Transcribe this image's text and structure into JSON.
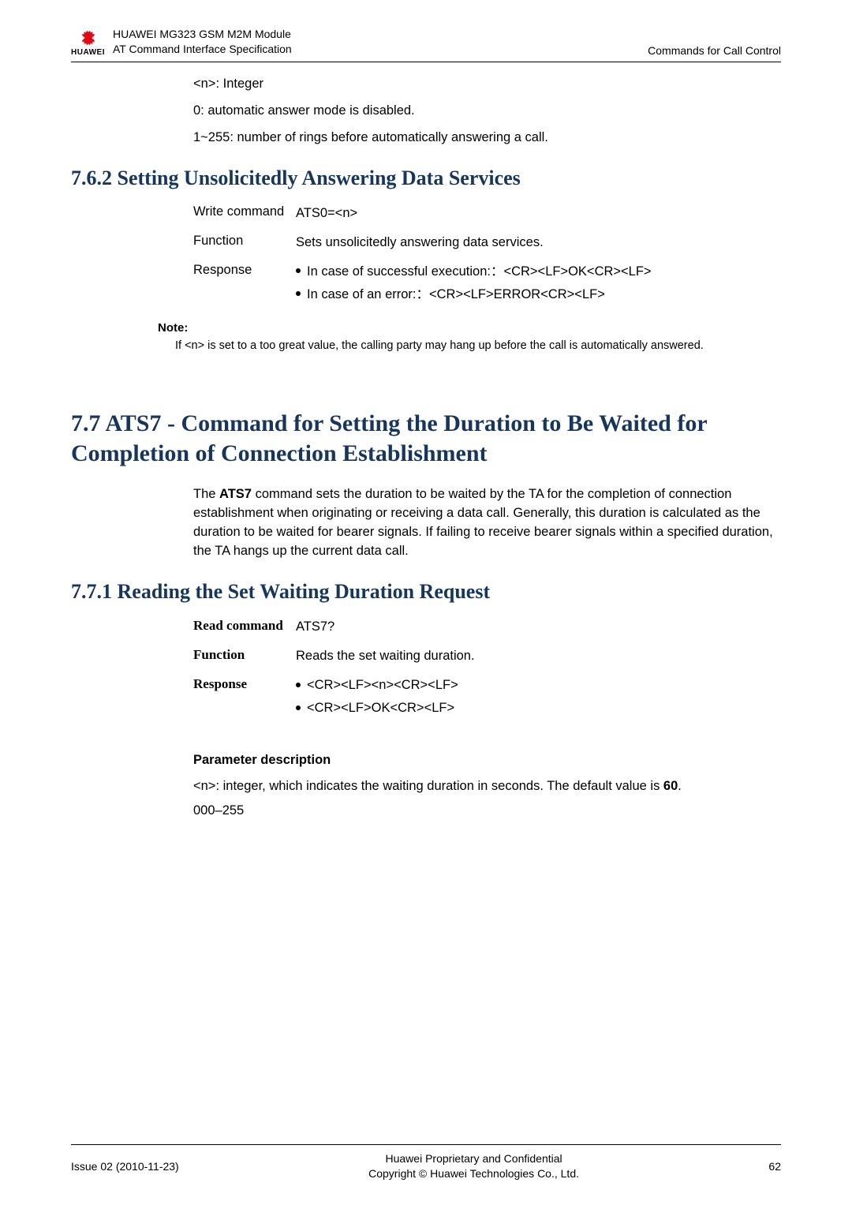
{
  "header": {
    "brand": "HUAWEI",
    "line1": "HUAWEI MG323 GSM M2M Module",
    "line2": "AT Command Interface Specification",
    "right": "Commands for Call Control"
  },
  "pre_section": {
    "p1": "<n>: Integer",
    "p2": "0: automatic answer mode is disabled.",
    "p3": "1~255: number of rings before automatically answering a call."
  },
  "s762": {
    "title": "7.6.2 Setting Unsolicitedly Answering Data Services",
    "rows": {
      "write_k": "Write command",
      "write_v": "ATS0=<n>",
      "func_k": "Function",
      "func_v": "Sets unsolicitedly answering data services.",
      "resp_k": "Response",
      "resp_b1": "In case of successful execution:：<CR><LF>OK<CR><LF>",
      "resp_b2": "In case of an error:：<CR><LF>ERROR<CR><LF>"
    },
    "note_title": "Note:",
    "note_body": "If <n> is set to a too great value, the calling party may hang up before the call is automatically answered."
  },
  "s77": {
    "title": "7.7 ATS7 - Command for Setting the Duration to Be Waited for Completion of Connection Establishment",
    "body_pre": "The ",
    "body_cmd": "ATS7",
    "body_post": " command sets the duration to be waited by the TA for the completion of connection establishment when originating or receiving a data call. Generally, this duration is calculated as the duration to be waited for bearer signals. If failing to receive bearer signals within a specified duration, the TA hangs up the current data call."
  },
  "s771": {
    "title": "7.7.1 Reading the Set Waiting Duration Request",
    "rows": {
      "read_k": "Read command",
      "read_v": "ATS7?",
      "func_k": "Function",
      "func_v": "Reads the set waiting duration.",
      "resp_k": "Response",
      "resp_b1": "<CR><LF><n><CR><LF>",
      "resp_b2": "<CR><LF>OK<CR><LF>"
    },
    "pd_title": "Parameter description",
    "pd_p1_pre": "<n>: integer, which indicates the waiting duration in seconds. The default value is ",
    "pd_p1_bold": "60",
    "pd_p1_post": ".",
    "pd_p2": "000–255"
  },
  "footer": {
    "left": "Issue 02 (2010-11-23)",
    "center1": "Huawei Proprietary and Confidential",
    "center2": "Copyright © Huawei Technologies Co., Ltd.",
    "right": "62"
  }
}
